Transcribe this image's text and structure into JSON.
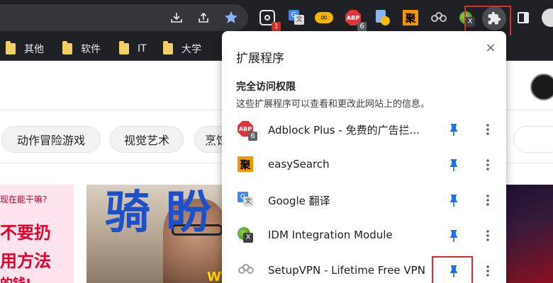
{
  "colors": {
    "toolbar_bg": "#202124",
    "accent_blue": "#1a73e8",
    "highlight_red": "#e02a2a"
  },
  "toolbar": {
    "icons": [
      "download-icon",
      "share-icon",
      "bookmark-star-icon"
    ],
    "extensions": [
      {
        "name": "ext-dark-icon",
        "badge": "1",
        "badge_color": "#d93025"
      },
      {
        "name": "google-translate-icon",
        "badge": "",
        "badge_color": ""
      },
      {
        "name": "infinity-icon",
        "badge": "",
        "badge_color": ""
      },
      {
        "name": "adblock-plus-icon",
        "badge": "6",
        "badge_color": "#5f6368"
      },
      {
        "name": "download-helper-icon",
        "badge": "",
        "badge_color": ""
      },
      {
        "name": "easysearch-icon",
        "badge": "",
        "badge_color": ""
      },
      {
        "name": "setupvpn-icon",
        "badge": "",
        "badge_color": ""
      },
      {
        "name": "idm-icon",
        "badge": "",
        "badge_color": ""
      }
    ],
    "extensions_button": "extensions-puzzle-icon",
    "side_panel": "side-panel-icon"
  },
  "bookmarks": [
    {
      "label": "其他"
    },
    {
      "label": "软件"
    },
    {
      "label": "IT"
    },
    {
      "label": "大学"
    }
  ],
  "page": {
    "chips": [
      "动作冒险游戏",
      "视觉艺术",
      "烹饪"
    ],
    "thumb1_lines": [
      "现在能干嘛?",
      "不要扔",
      "用方法",
      "的钱!"
    ],
    "thumb2_title": "骑 盼",
    "thumb2_caption": "WT"
  },
  "popup": {
    "title": "扩展程序",
    "close_icon": "×",
    "section_title": "完全访问权限",
    "section_desc": "这些扩展程序可以查看和更改此网站上的信息。",
    "items": [
      {
        "name": "Adblock Plus - 免费的广告拦...",
        "icon": "adblock-plus-icon",
        "badge": "6",
        "pinned": true
      },
      {
        "name": "easySearch",
        "icon": "easysearch-icon",
        "badge": "",
        "pinned": true
      },
      {
        "name": "Google 翻译",
        "icon": "google-translate-icon",
        "badge": "",
        "pinned": true
      },
      {
        "name": "IDM Integration Module",
        "icon": "idm-icon",
        "badge": "",
        "pinned": true
      },
      {
        "name": "SetupVPN - Lifetime Free VPN",
        "icon": "setupvpn-icon",
        "badge": "",
        "pinned": true
      }
    ]
  }
}
